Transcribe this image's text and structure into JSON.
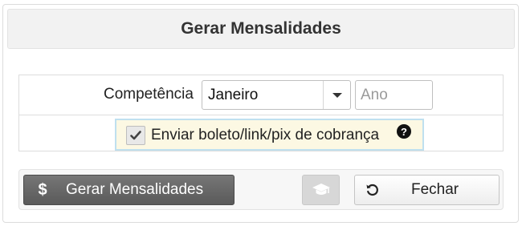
{
  "dialog": {
    "title": "Gerar Mensalidades"
  },
  "form": {
    "competencia_label": "Competência",
    "month_selected": "Janeiro",
    "year_placeholder": "Ano",
    "year_value": "",
    "send_checkbox_label": "Enviar boleto/link/pix de cobrança",
    "send_checkbox_checked": true,
    "help_glyph": "?"
  },
  "footer": {
    "generate_button_icon": "$",
    "generate_button_label": "Gerar Mensalidades",
    "close_button_label": "Fechar"
  },
  "icons": {
    "generate": "dollar-icon",
    "graduation": "graduation-cap-icon",
    "close": "undo-icon",
    "dropdown": "caret-down-icon",
    "check": "check-icon",
    "help": "question-circle-icon"
  },
  "colors": {
    "header_bg": "#f2f2f2",
    "checkbox_row_bg": "#fcf8e3",
    "checkbox_row_border": "#bfe0ef",
    "generate_button_bg": "#5f5f5f",
    "disabled_button_bg": "#d7d7d7"
  }
}
